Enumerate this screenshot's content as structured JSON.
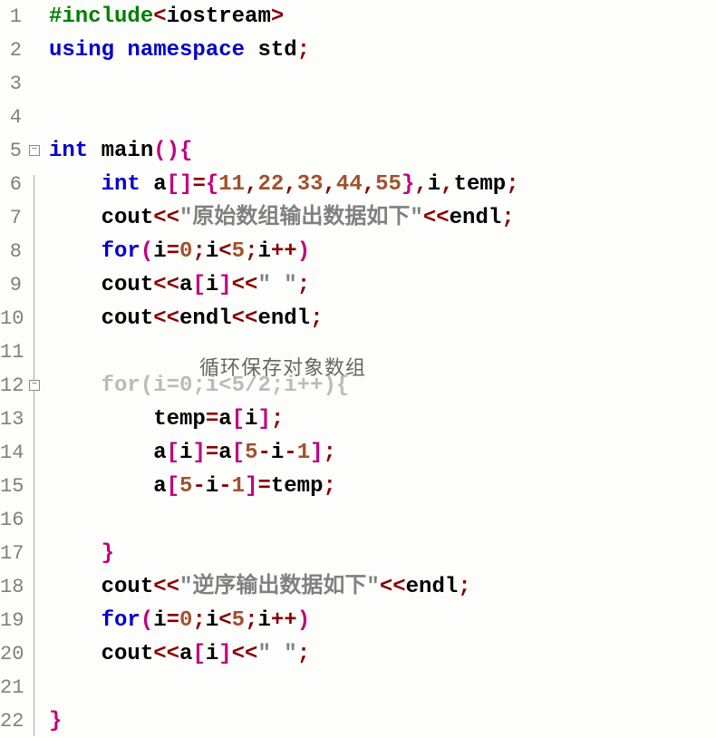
{
  "watermark": "循环保存对象数组",
  "fold": {
    "markers": [
      {
        "line": 5,
        "symbol": "−"
      },
      {
        "line": 12,
        "symbol": "−"
      }
    ],
    "vlines": [
      {
        "from": 6,
        "to": 22
      },
      {
        "from": 13,
        "to": 16
      }
    ]
  },
  "gutter": [
    "1",
    "2",
    "3",
    "4",
    "5",
    "6",
    "7",
    "8",
    "9",
    "10",
    "11",
    "12",
    "13",
    "14",
    "15",
    "16",
    "17",
    "18",
    "19",
    "20",
    "21",
    "22"
  ],
  "code": [
    [
      {
        "cls": "pre",
        "t": "#include"
      },
      {
        "cls": "pnc",
        "t": "<"
      },
      {
        "cls": "txt",
        "t": "iostream"
      },
      {
        "cls": "pnc",
        "t": ">"
      }
    ],
    [
      {
        "cls": "kw",
        "t": "using namespace"
      },
      {
        "cls": "txt",
        "t": " std"
      },
      {
        "cls": "pnc",
        "t": ";"
      }
    ],
    [],
    [],
    [
      {
        "cls": "kw",
        "t": "int"
      },
      {
        "cls": "txt",
        "t": " main"
      },
      {
        "cls": "brk",
        "t": "()"
      },
      {
        "cls": "brk",
        "t": "{"
      }
    ],
    [
      {
        "cls": "txt",
        "t": "    "
      },
      {
        "cls": "kw",
        "t": "int"
      },
      {
        "cls": "txt",
        "t": " a"
      },
      {
        "cls": "brk",
        "t": "[]"
      },
      {
        "cls": "pnc",
        "t": "="
      },
      {
        "cls": "brk",
        "t": "{"
      },
      {
        "cls": "num",
        "t": "11"
      },
      {
        "cls": "pnc",
        "t": ","
      },
      {
        "cls": "num",
        "t": "22"
      },
      {
        "cls": "pnc",
        "t": ","
      },
      {
        "cls": "num",
        "t": "33"
      },
      {
        "cls": "pnc",
        "t": ","
      },
      {
        "cls": "num",
        "t": "44"
      },
      {
        "cls": "pnc",
        "t": ","
      },
      {
        "cls": "num",
        "t": "55"
      },
      {
        "cls": "brk",
        "t": "}"
      },
      {
        "cls": "pnc",
        "t": ","
      },
      {
        "cls": "txt",
        "t": "i"
      },
      {
        "cls": "pnc",
        "t": ","
      },
      {
        "cls": "txt",
        "t": "temp"
      },
      {
        "cls": "pnc",
        "t": ";"
      }
    ],
    [
      {
        "cls": "txt",
        "t": "    cout"
      },
      {
        "cls": "pnc",
        "t": "<<"
      },
      {
        "cls": "str",
        "t": "\"原始数组输出数据如下\""
      },
      {
        "cls": "pnc",
        "t": "<<"
      },
      {
        "cls": "txt",
        "t": "endl"
      },
      {
        "cls": "pnc",
        "t": ";"
      }
    ],
    [
      {
        "cls": "txt",
        "t": "    "
      },
      {
        "cls": "kw",
        "t": "for"
      },
      {
        "cls": "brk",
        "t": "("
      },
      {
        "cls": "txt",
        "t": "i"
      },
      {
        "cls": "pnc",
        "t": "="
      },
      {
        "cls": "num",
        "t": "0"
      },
      {
        "cls": "pnc",
        "t": ";"
      },
      {
        "cls": "txt",
        "t": "i"
      },
      {
        "cls": "pnc",
        "t": "<"
      },
      {
        "cls": "num",
        "t": "5"
      },
      {
        "cls": "pnc",
        "t": ";"
      },
      {
        "cls": "txt",
        "t": "i"
      },
      {
        "cls": "pnc",
        "t": "++"
      },
      {
        "cls": "brk",
        "t": ")"
      }
    ],
    [
      {
        "cls": "txt",
        "t": "    cout"
      },
      {
        "cls": "pnc",
        "t": "<<"
      },
      {
        "cls": "txt",
        "t": "a"
      },
      {
        "cls": "brk",
        "t": "["
      },
      {
        "cls": "txt",
        "t": "i"
      },
      {
        "cls": "brk",
        "t": "]"
      },
      {
        "cls": "pnc",
        "t": "<<"
      },
      {
        "cls": "str",
        "t": "\" \""
      },
      {
        "cls": "pnc",
        "t": ";"
      }
    ],
    [
      {
        "cls": "txt",
        "t": "    cout"
      },
      {
        "cls": "pnc",
        "t": "<<"
      },
      {
        "cls": "txt",
        "t": "endl"
      },
      {
        "cls": "pnc",
        "t": "<<"
      },
      {
        "cls": "txt",
        "t": "endl"
      },
      {
        "cls": "pnc",
        "t": ";"
      }
    ],
    [],
    [
      {
        "cls": "txt",
        "t": "    "
      },
      {
        "cls": "dim",
        "t": "for"
      },
      {
        "cls": "dim",
        "t": "("
      },
      {
        "cls": "dim",
        "t": "i"
      },
      {
        "cls": "dim",
        "t": "="
      },
      {
        "cls": "dim",
        "t": "0"
      },
      {
        "cls": "dim",
        "t": ";"
      },
      {
        "cls": "dim",
        "t": "i<5/2;i++){"
      }
    ],
    [
      {
        "cls": "txt",
        "t": "        temp"
      },
      {
        "cls": "pnc",
        "t": "="
      },
      {
        "cls": "txt",
        "t": "a"
      },
      {
        "cls": "brk",
        "t": "["
      },
      {
        "cls": "txt",
        "t": "i"
      },
      {
        "cls": "brk",
        "t": "]"
      },
      {
        "cls": "pnc",
        "t": ";"
      }
    ],
    [
      {
        "cls": "txt",
        "t": "        a"
      },
      {
        "cls": "brk",
        "t": "["
      },
      {
        "cls": "txt",
        "t": "i"
      },
      {
        "cls": "brk",
        "t": "]"
      },
      {
        "cls": "pnc",
        "t": "="
      },
      {
        "cls": "txt",
        "t": "a"
      },
      {
        "cls": "brk",
        "t": "["
      },
      {
        "cls": "num",
        "t": "5"
      },
      {
        "cls": "pnc",
        "t": "-"
      },
      {
        "cls": "txt",
        "t": "i"
      },
      {
        "cls": "pnc",
        "t": "-"
      },
      {
        "cls": "num",
        "t": "1"
      },
      {
        "cls": "brk",
        "t": "]"
      },
      {
        "cls": "pnc",
        "t": ";"
      }
    ],
    [
      {
        "cls": "txt",
        "t": "        a"
      },
      {
        "cls": "brk",
        "t": "["
      },
      {
        "cls": "num",
        "t": "5"
      },
      {
        "cls": "pnc",
        "t": "-"
      },
      {
        "cls": "txt",
        "t": "i"
      },
      {
        "cls": "pnc",
        "t": "-"
      },
      {
        "cls": "num",
        "t": "1"
      },
      {
        "cls": "brk",
        "t": "]"
      },
      {
        "cls": "pnc",
        "t": "="
      },
      {
        "cls": "txt",
        "t": "temp"
      },
      {
        "cls": "pnc",
        "t": ";"
      }
    ],
    [],
    [
      {
        "cls": "txt",
        "t": "    "
      },
      {
        "cls": "brk",
        "t": "}"
      }
    ],
    [
      {
        "cls": "txt",
        "t": "    cout"
      },
      {
        "cls": "pnc",
        "t": "<<"
      },
      {
        "cls": "str",
        "t": "\"逆序输出数据如下\""
      },
      {
        "cls": "pnc",
        "t": "<<"
      },
      {
        "cls": "txt",
        "t": "endl"
      },
      {
        "cls": "pnc",
        "t": ";"
      }
    ],
    [
      {
        "cls": "txt",
        "t": "    "
      },
      {
        "cls": "kw",
        "t": "for"
      },
      {
        "cls": "brk",
        "t": "("
      },
      {
        "cls": "txt",
        "t": "i"
      },
      {
        "cls": "pnc",
        "t": "="
      },
      {
        "cls": "num",
        "t": "0"
      },
      {
        "cls": "pnc",
        "t": ";"
      },
      {
        "cls": "txt",
        "t": "i"
      },
      {
        "cls": "pnc",
        "t": "<"
      },
      {
        "cls": "num",
        "t": "5"
      },
      {
        "cls": "pnc",
        "t": ";"
      },
      {
        "cls": "txt",
        "t": "i"
      },
      {
        "cls": "pnc",
        "t": "++"
      },
      {
        "cls": "brk",
        "t": ")"
      }
    ],
    [
      {
        "cls": "txt",
        "t": "    cout"
      },
      {
        "cls": "pnc",
        "t": "<<"
      },
      {
        "cls": "txt",
        "t": "a"
      },
      {
        "cls": "brk",
        "t": "["
      },
      {
        "cls": "txt",
        "t": "i"
      },
      {
        "cls": "brk",
        "t": "]"
      },
      {
        "cls": "pnc",
        "t": "<<"
      },
      {
        "cls": "str",
        "t": "\" \""
      },
      {
        "cls": "pnc",
        "t": ";"
      }
    ],
    [],
    [
      {
        "cls": "brk",
        "t": "}"
      }
    ]
  ]
}
